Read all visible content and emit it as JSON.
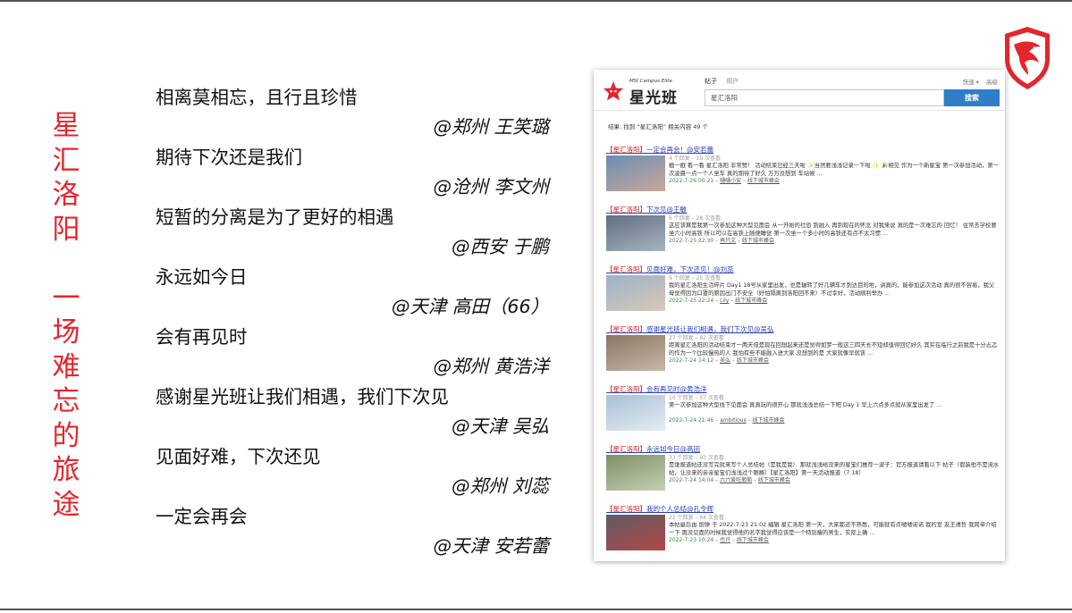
{
  "slide": {
    "vertical_title": "星汇洛阳 一场难忘的旅途",
    "quotes": [
      {
        "text": "相离莫相忘，且行且珍惜",
        "author": "@郑州 王笑璐"
      },
      {
        "text": "期待下次还是我们",
        "author": "@沧州 李文州"
      },
      {
        "text": "短暂的分离是为了更好的相遇",
        "author": "@西安 于鹏"
      },
      {
        "text": "永远如今日",
        "author": "@天津 高田（66）"
      },
      {
        "text": "会有再见时",
        "author": "@郑州 黄浩洋"
      },
      {
        "text": "感谢星光班让我们相遇，我们下次见",
        "author": "@天津 吴弘"
      },
      {
        "text": "见面好难，下次还见",
        "author": "@郑州 刘蕊"
      },
      {
        "text": "一定会再会",
        "author": "@天津 安若蕾"
      }
    ],
    "logo_icon": "msi-dragon-shield-icon"
  },
  "browser": {
    "brand_sub": "MSI Campus Elite",
    "brand": "星光班",
    "tabs": [
      "帖子",
      "用户"
    ],
    "top_links": [
      "快速 ▾",
      "高级"
    ],
    "search_value": "星汇洛阳",
    "search_button": "搜索",
    "result_count": "结果: 找到 “星汇洛阳” 相关内容 49 个",
    "results": [
      {
        "title_red": "【星汇洛阳】",
        "title": "一定会再会！@安若蕾",
        "meta": "4 个回复 – 19 次查看",
        "snippet": "戳一戳 看一看 星汇洛阳 非常赞！ 活动结束已经三天啦 ✨当然要浅浅记录一下啦 ✨ 🎉相见 作为一个新星宝 第一次参加活动，第一次凌晨一点一个人坐车 真的期待了好久 万万没想到 车站候 ...",
        "date": "2022-7-26 00:21",
        "author": "嗵嗵小安",
        "forum": "线下城市峰会"
      },
      {
        "title_red": "【星汇洛阳】",
        "title": "下次见@王敏",
        "meta": "6 个回复 – 28 次查看",
        "snippet": "这应该算是我第一次参加这种大型见面会 从一开始的社恐 到融入 再到现在的怀念 对我来说 真的是一次难忘的 回忆！ 往常去学校要坐六小时高铁 所以可以在高铁上随便睡觉 第一次坐一个多小时的高铁还有点不太习惯 ...",
        "date": "2022-7-25 22:30",
        "author": "再只文",
        "forum": "线下城市峰会"
      },
      {
        "title_red": "【星汇洛阳】",
        "title": "见面好难，下次还见！@刘蕊",
        "meta": "9 个回复 – 25 次查看",
        "snippet": "我的星汇洛阳生活碎片 Day1 18号从家里出发，也是辗转了好几辆车才到达目的地，讲真的，能参加这次活动 真的很不容易，我父母觉得因为口罩的原因出门不安全（好怕隔离到洛阳回不来）不过幸好，活动顺利举办 ...",
        "date": "2022-7-25 22:24",
        "author": "Lily",
        "forum": "线下城市峰会"
      },
      {
        "title_red": "【星汇洛阳】",
        "title": "感谢星光班让我们相遇，我们下次见@吴弘",
        "meta": "27 个回复 – 82 次查看",
        "snippet": "距离星汇洛阳的活动结束才一两天但是现在回想起来还是觉得如梦一般这三四天长不短却值得回忆好久 其实在临行之前我是十分忐忑的作为一个比较慢热的人 我怕有些不能融入进大家 没想到的是 大家就像早就该 ...",
        "date": "2022-7-24 14:12",
        "author": "吴弘",
        "forum": "线下城市峰会"
      },
      {
        "title_red": "【星汇洛阳】",
        "title": "会有再见时@黄浩洋",
        "meta": "10 个回复 – 57 次查看",
        "snippet": "第一次参加这种大型线下见面会 真真玩的很开心 那就浅浅总结一下吧 Day 1 早上六点多点就从家里出发了 ...",
        "date": "2022-7-24 21:46",
        "author": "ambitious",
        "forum": "线下城市峰会"
      },
      {
        "title_red": "【星汇洛阳】",
        "title": "永远如今日@高田",
        "meta": "33 个回复 – 93 次查看",
        "snippet": "是谁报道帖还没写完就来写个人总结帖（是我是我） 那就浅浅给没来的星宝们推荐一波子：官方报道请看以下 帖子（假装他不是流水帖，让没来的亲亲星宝们浅浅过个眼瘾）【星汇洛阳】第一天活动报道（7.18）",
        "date": "2022-7-24 14:04",
        "author": "六六爱吃葡萄",
        "forum": "线下城市峰会"
      },
      {
        "title_red": "【星汇洛阳】",
        "title": "我的个人总结@孔令辉",
        "meta": "22 个回复 – 64 次查看",
        "snippet": "本帖最后由 炮弹 于 2022-7-23 21:02 编辑 星汇洛阳 第一天，大家都还不熟悉，可能就有点嘘嘘诺诺 我的室 友王潇哲 我简单介绍一下 再没见面的时候我觉得他的名字我觉得应该是一个特别瘦的男生，实际上确 ...",
        "date": "2022-7-23 10:24",
        "author": "也许",
        "forum": "线下城市峰会"
      }
    ]
  }
}
